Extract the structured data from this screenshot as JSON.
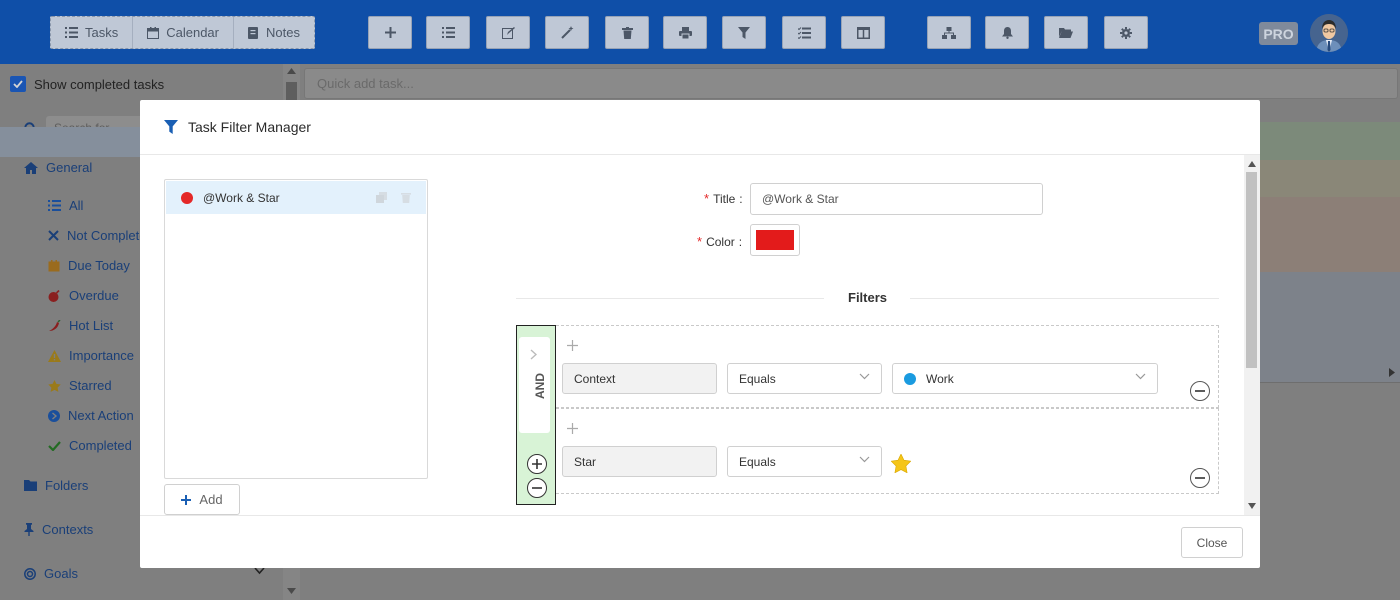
{
  "toolbar": {
    "view_tabs": [
      {
        "label": "Tasks",
        "icon": "list-icon"
      },
      {
        "label": "Calendar",
        "icon": "calendar-icon"
      },
      {
        "label": "Notes",
        "icon": "notes-icon"
      }
    ],
    "buttons": [
      "add-task-icon",
      "list-icon",
      "edit-icon",
      "magic-wand-icon",
      "trash-icon",
      "print-icon",
      "filter-icon",
      "checklist-icon",
      "columns-icon",
      "sitemap-icon",
      "bell-icon",
      "folder-open-icon",
      "gear-icon"
    ],
    "pro_badge": "PRO"
  },
  "sidebar": {
    "show_completed_label": "Show completed tasks",
    "search_placeholder": "Search for ...",
    "general_label": "General",
    "items": [
      {
        "label": "All",
        "icon": "list-icon",
        "color": "#1a4f9c"
      },
      {
        "label": "Not Complete",
        "icon": "x-icon",
        "color": "#1a3f78"
      },
      {
        "label": "Due Today",
        "icon": "calendar-icon",
        "color": "#9a6b1e"
      },
      {
        "label": "Overdue",
        "icon": "bomb-icon",
        "color": "#8a1f1f"
      },
      {
        "label": "Hot List",
        "icon": "pepper-icon",
        "color": "#8a1f1f"
      },
      {
        "label": "Importance",
        "icon": "warning-icon",
        "color": "#9a7a1a"
      },
      {
        "label": "Starred",
        "icon": "star-icon",
        "color": "#9a7a1a"
      },
      {
        "label": "Next Action",
        "icon": "next-icon",
        "color": "#1a4f9c"
      },
      {
        "label": "Completed",
        "icon": "check-icon",
        "color": "#236b23"
      }
    ],
    "sections": [
      {
        "label": "Folders",
        "icon": "folder-icon"
      },
      {
        "label": "Contexts",
        "icon": "pin-icon"
      },
      {
        "label": "Goals",
        "icon": "target-icon"
      }
    ]
  },
  "main": {
    "quick_add_placeholder": "Quick add task..."
  },
  "modal": {
    "title": "Task Filter Manager",
    "filter_list": [
      {
        "name": "@Work & Star",
        "color": "#e42828"
      }
    ],
    "add_label": "Add",
    "title_label": "Title",
    "title_value": "@Work & Star",
    "color_label": "Color",
    "color_value": "#e31b1b",
    "filters_heading": "Filters",
    "group_operator": "AND",
    "rules": [
      {
        "field": "Context",
        "operator": "Equals",
        "value": "Work",
        "value_color": "#1a9be0"
      },
      {
        "field": "Star",
        "operator": "Equals",
        "value_icon": "star-icon",
        "value_color": "#f5c518"
      }
    ],
    "close_label": "Close"
  }
}
